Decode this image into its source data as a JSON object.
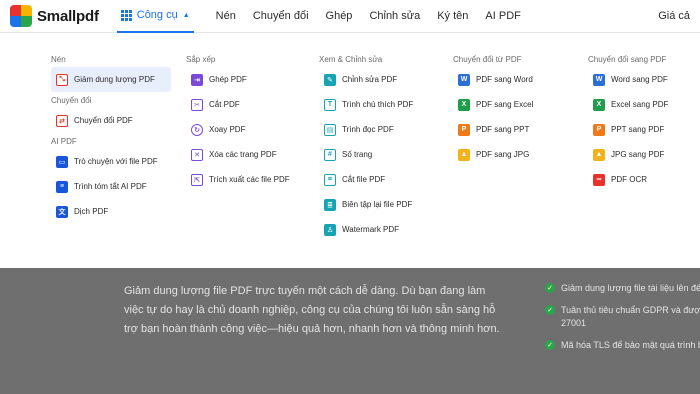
{
  "header": {
    "logo_text": "Smallpdf",
    "tools_label": "Công cụ",
    "nav": [
      "Nén",
      "Chuyển đổi",
      "Ghép",
      "Chỉnh sửa",
      "Ký tên",
      "AI PDF"
    ],
    "right_label": "Giá cả"
  },
  "dropdown": {
    "col1": {
      "title": "Nén",
      "items": [
        {
          "label": "Giảm dung lượng PDF",
          "icon": "compress-icon",
          "color": "#e5322d"
        }
      ],
      "title2": "Chuyển đổi",
      "items2": [
        {
          "label": "Chuyển đổi PDF",
          "icon": "convert-icon",
          "color": "#e5322d"
        }
      ],
      "title3": "AI PDF",
      "items3": [
        {
          "label": "Trò chuyện với file PDF",
          "icon": "chat-icon",
          "color": "#1a56db"
        },
        {
          "label": "Trình tóm tắt AI PDF",
          "icon": "summary-icon",
          "color": "#1a56db"
        },
        {
          "label": "Dịch PDF",
          "icon": "translate-icon",
          "color": "#1a56db"
        }
      ]
    },
    "col2": {
      "title": "Sắp xếp",
      "items": [
        {
          "label": "Ghép PDF",
          "icon": "merge-icon",
          "color": "#7a4bd6"
        },
        {
          "label": "Cắt PDF",
          "icon": "split-icon",
          "color": "#7a4bd6"
        },
        {
          "label": "Xoay PDF",
          "icon": "rotate-icon",
          "color": "#7a4bd6"
        },
        {
          "label": "Xóa các trang PDF",
          "icon": "delete-pages-icon",
          "color": "#7a4bd6"
        },
        {
          "label": "Trích xuất các file PDF",
          "icon": "extract-icon",
          "color": "#7a4bd6"
        }
      ]
    },
    "col3": {
      "title": "Xem & Chỉnh sửa",
      "items": [
        {
          "label": "Chỉnh sửa PDF",
          "icon": "edit-icon",
          "color": "#18a3b3"
        },
        {
          "label": "Trình chú thích PDF",
          "icon": "annotate-icon",
          "color": "#18a3b3"
        },
        {
          "label": "Trình đọc PDF",
          "icon": "reader-icon",
          "color": "#18a3b3"
        },
        {
          "label": "Số trang",
          "icon": "page-number-icon",
          "color": "#18a3b3"
        },
        {
          "label": "Cắt file PDF",
          "icon": "crop-icon",
          "color": "#18a3b3"
        },
        {
          "label": "Biên tập lại file PDF",
          "icon": "redact-icon",
          "color": "#18a3b3"
        },
        {
          "label": "Watermark PDF",
          "icon": "watermark-icon",
          "color": "#18a3b3"
        }
      ]
    },
    "col4": {
      "title": "Chuyển đổi từ PDF",
      "items": [
        {
          "label": "PDF sang Word",
          "icon": "word-icon",
          "color": "#2b6fd6",
          "glyph": "W"
        },
        {
          "label": "PDF sang Excel",
          "icon": "excel-icon",
          "color": "#1f9d4b",
          "glyph": "X"
        },
        {
          "label": "PDF sang PPT",
          "icon": "ppt-icon",
          "color": "#f07a1a",
          "glyph": "P"
        },
        {
          "label": "PDF sang JPG",
          "icon": "jpg-icon",
          "color": "#f1b21c",
          "glyph": "▲"
        }
      ]
    },
    "col5": {
      "title": "Chuyển đổi sang PDF",
      "items": [
        {
          "label": "Word sang PDF",
          "icon": "word-icon",
          "color": "#2b6fd6",
          "glyph": "W"
        },
        {
          "label": "Excel sang PDF",
          "icon": "excel-icon",
          "color": "#1f9d4b",
          "glyph": "X"
        },
        {
          "label": "PPT sang PDF",
          "icon": "ppt-icon",
          "color": "#f07a1a",
          "glyph": "P"
        },
        {
          "label": "JPG sang PDF",
          "icon": "jpg-icon",
          "color": "#f1b21c",
          "glyph": "▲"
        },
        {
          "label": "PDF OCR",
          "icon": "ocr-icon",
          "color": "#e5322d",
          "glyph": "∞"
        }
      ]
    }
  },
  "background": {
    "paragraph": "Giảm dung lượng file PDF trực tuyến một cách dễ dàng. Dù bạn đang làm việc tự do hay là chủ doanh nghiệp, công cụ của chúng tôi luôn sẵn sàng hỗ trợ bạn hoàn thành công việc—hiệu quả hơn, nhanh hơn và thông minh hơn.",
    "checks": [
      "Giảm dung lượng file tài liệu lên đến",
      "Tuân thủ tiêu chuẩn GDPR và được ch",
      "27001",
      "Mã hóa TLS để bảo mật quá trình bảo"
    ]
  }
}
